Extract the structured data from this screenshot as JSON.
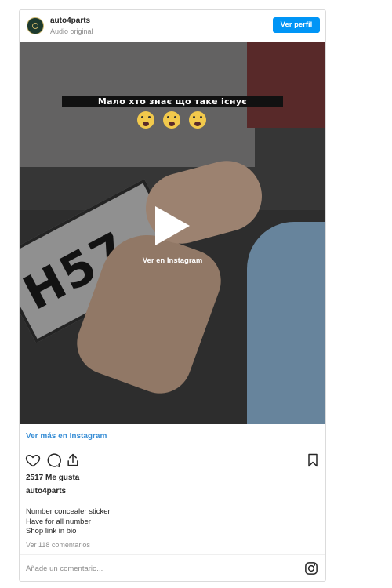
{
  "header": {
    "username": "auto4parts",
    "subtitle": "Audio original",
    "profile_button": "Ver perfil"
  },
  "media": {
    "overlay_caption": "Мало хто знає що таке існує",
    "emojis": [
      "scream-emoji",
      "scream-emoji",
      "scream-emoji"
    ],
    "plate_text": "H57",
    "watch_label": "Ver en Instagram"
  },
  "more_link": "Ver más en Instagram",
  "stats": {
    "likes": "2517 Me gusta"
  },
  "post": {
    "username": "auto4parts",
    "caption_lines": [
      "Number concealer sticker",
      "Have for all number",
      "Shop link in bio"
    ],
    "comments_link": "Ver 118 comentarios"
  },
  "comment_input": {
    "placeholder": "Añade un comentario..."
  },
  "colors": {
    "accent": "#0095f6",
    "link": "#3a8fd6",
    "muted": "#8e8e8e"
  }
}
